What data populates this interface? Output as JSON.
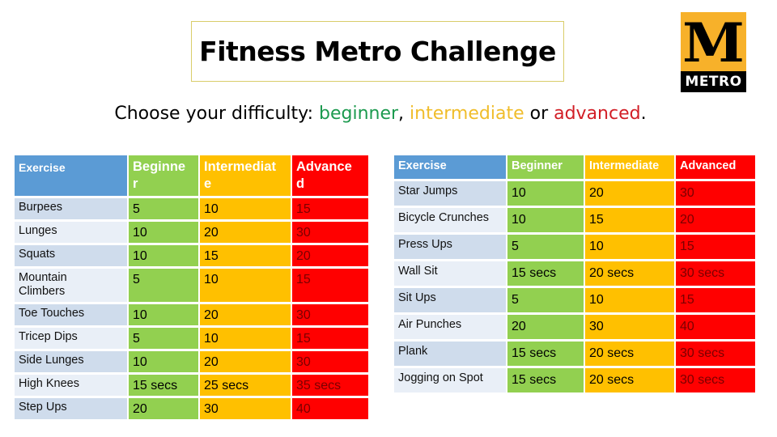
{
  "title": "Fitness Metro Challenge",
  "logo": {
    "letter": "M",
    "text": "METRO",
    "colors": {
      "background": "#f7b12a",
      "band": "#000000"
    }
  },
  "subtitle": {
    "prefix": "Choose your difficulty: ",
    "beginner": "beginner",
    "sep1": ", ",
    "intermediate": "intermediate",
    "sep2": " or ",
    "advanced": "advanced",
    "suffix": "."
  },
  "colors": {
    "beginner": "#92d050",
    "intermediate": "#ffc000",
    "advanced": "#ff0000",
    "exercise_header": "#5b9bd5"
  },
  "left_table": {
    "headers": {
      "exercise": "Exercise",
      "beginner_l1": "Beginne",
      "beginner_l2": "r",
      "intermediate_l1": "Intermediat",
      "intermediate_l2": "e",
      "advanced_l1": "Advance",
      "advanced_l2": "d"
    },
    "rows": [
      {
        "exercise": "Burpees",
        "beginner": "5",
        "intermediate": "10",
        "advanced": "15"
      },
      {
        "exercise": "Lunges",
        "beginner": "10",
        "intermediate": "20",
        "advanced": "30"
      },
      {
        "exercise": "Squats",
        "beginner": "10",
        "intermediate": "15",
        "advanced": "20"
      },
      {
        "exercise": "Mountain Climbers",
        "beginner": "5",
        "intermediate": "10",
        "advanced": "15"
      },
      {
        "exercise": "Toe Touches",
        "beginner": "10",
        "intermediate": "20",
        "advanced": "30"
      },
      {
        "exercise": "Tricep Dips",
        "beginner": "5",
        "intermediate": "10",
        "advanced": "15"
      },
      {
        "exercise": "Side Lunges",
        "beginner": "10",
        "intermediate": "20",
        "advanced": "30"
      },
      {
        "exercise": "High Knees",
        "beginner": "15 secs",
        "intermediate": "25 secs",
        "advanced": "35 secs"
      },
      {
        "exercise": "Step Ups",
        "beginner": "20",
        "intermediate": "30",
        "advanced": "40"
      }
    ]
  },
  "right_table": {
    "headers": {
      "exercise": "Exercise",
      "beginner": "Beginner",
      "intermediate": "Intermediate",
      "advanced": "Advanced"
    },
    "rows": [
      {
        "exercise": "Star Jumps",
        "beginner": "10",
        "intermediate": "20",
        "advanced": "30"
      },
      {
        "exercise": "Bicycle Crunches",
        "beginner": "10",
        "intermediate": "15",
        "advanced": "20"
      },
      {
        "exercise": "Press Ups",
        "beginner": "5",
        "intermediate": "10",
        "advanced": "15"
      },
      {
        "exercise": "Wall Sit",
        "beginner": "15 secs",
        "intermediate": "20 secs",
        "advanced": "30 secs"
      },
      {
        "exercise": "Sit Ups",
        "beginner": "5",
        "intermediate": "10",
        "advanced": "15"
      },
      {
        "exercise": "Air Punches",
        "beginner": "20",
        "intermediate": "30",
        "advanced": "40"
      },
      {
        "exercise": "Plank",
        "beginner": "15 secs",
        "intermediate": "20 secs",
        "advanced": "30 secs"
      },
      {
        "exercise": "Jogging on Spot",
        "beginner": "15 secs",
        "intermediate": "20 secs",
        "advanced": "30 secs"
      }
    ]
  }
}
